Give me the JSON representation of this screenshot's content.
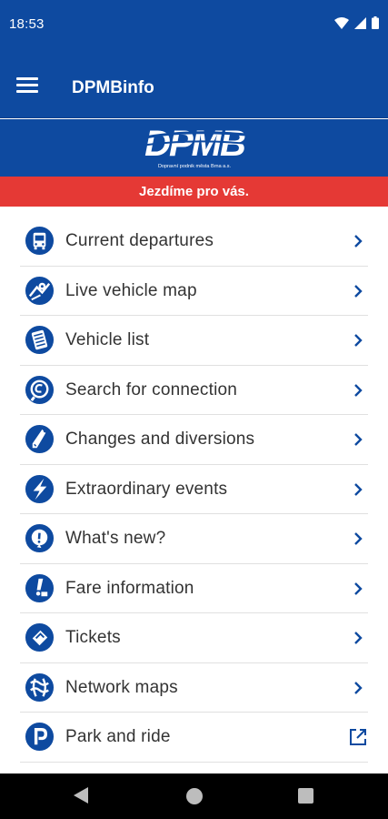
{
  "status_bar": {
    "time": "18:53"
  },
  "app_bar": {
    "title": "DPMBinfo"
  },
  "logo": {
    "text": "DPMB",
    "subtitle": "Dopravní podnik města Brna a.s."
  },
  "slogan": "Jezdíme pro vás.",
  "colors": {
    "brand_blue": "#0e4aa0",
    "slogan_red": "#e53935",
    "icon_blue": "#0e4aa0"
  },
  "menu": {
    "items": [
      {
        "label": "Current departures",
        "icon": "bus-icon",
        "action": "chevron"
      },
      {
        "label": "Live vehicle map",
        "icon": "map-pin-icon",
        "action": "chevron"
      },
      {
        "label": "Vehicle list",
        "icon": "list-icon",
        "action": "chevron"
      },
      {
        "label": "Search for connection",
        "icon": "connection-search-icon",
        "action": "chevron"
      },
      {
        "label": "Changes and diversions",
        "icon": "diversion-icon",
        "action": "chevron"
      },
      {
        "label": "Extraordinary events",
        "icon": "lightning-icon",
        "action": "chevron"
      },
      {
        "label": "What's new?",
        "icon": "question-icon",
        "action": "chevron"
      },
      {
        "label": "Fare information",
        "icon": "fare-info-icon",
        "action": "chevron"
      },
      {
        "label": "Tickets",
        "icon": "ticket-icon",
        "action": "chevron"
      },
      {
        "label": "Network maps",
        "icon": "network-map-icon",
        "action": "chevron"
      },
      {
        "label": "Park and ride",
        "icon": "parking-icon",
        "action": "external-link"
      }
    ]
  }
}
